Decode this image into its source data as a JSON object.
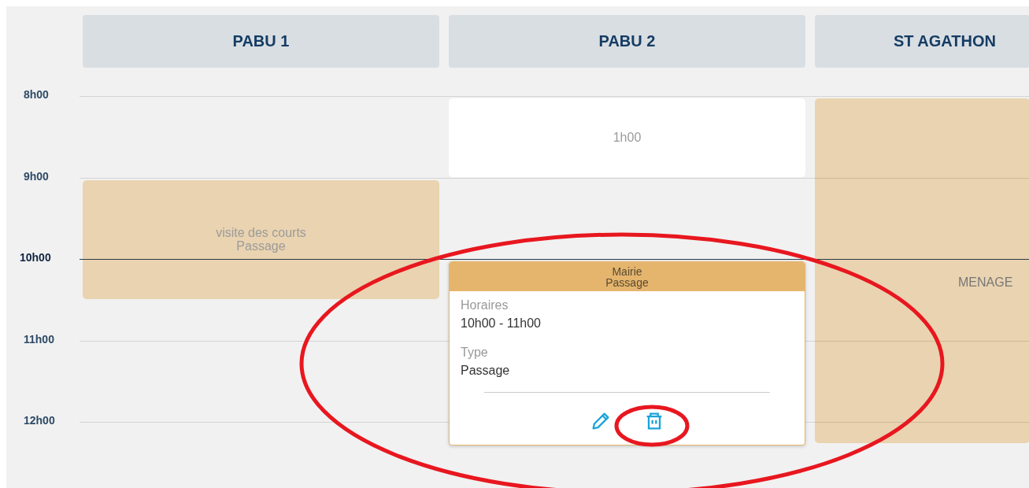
{
  "hours": [
    {
      "label": "8h00",
      "current": false
    },
    {
      "label": "9h00",
      "current": false
    },
    {
      "label": "10h00",
      "current": true
    },
    {
      "label": "11h00",
      "current": false
    },
    {
      "label": "12h00",
      "current": false
    }
  ],
  "columns": [
    {
      "title": "PABU 1",
      "events": [
        {
          "kind": "block",
          "lines": [
            "visite des courts",
            "Passage"
          ]
        }
      ]
    },
    {
      "title": "PABU 2",
      "events": [
        {
          "kind": "free",
          "lines": [
            "1h00"
          ]
        },
        {
          "kind": "popover",
          "header": [
            "Mairie",
            "Passage"
          ],
          "fields": [
            {
              "label": "Horaires",
              "value": "10h00 - 11h00"
            },
            {
              "label": "Type",
              "value": "Passage"
            }
          ],
          "actions": [
            {
              "kind": "edit"
            },
            {
              "kind": "delete"
            }
          ]
        }
      ]
    },
    {
      "title": "ST AGATHON",
      "events": [
        {
          "kind": "block",
          "lines": [
            "MENAGE"
          ]
        }
      ]
    }
  ]
}
